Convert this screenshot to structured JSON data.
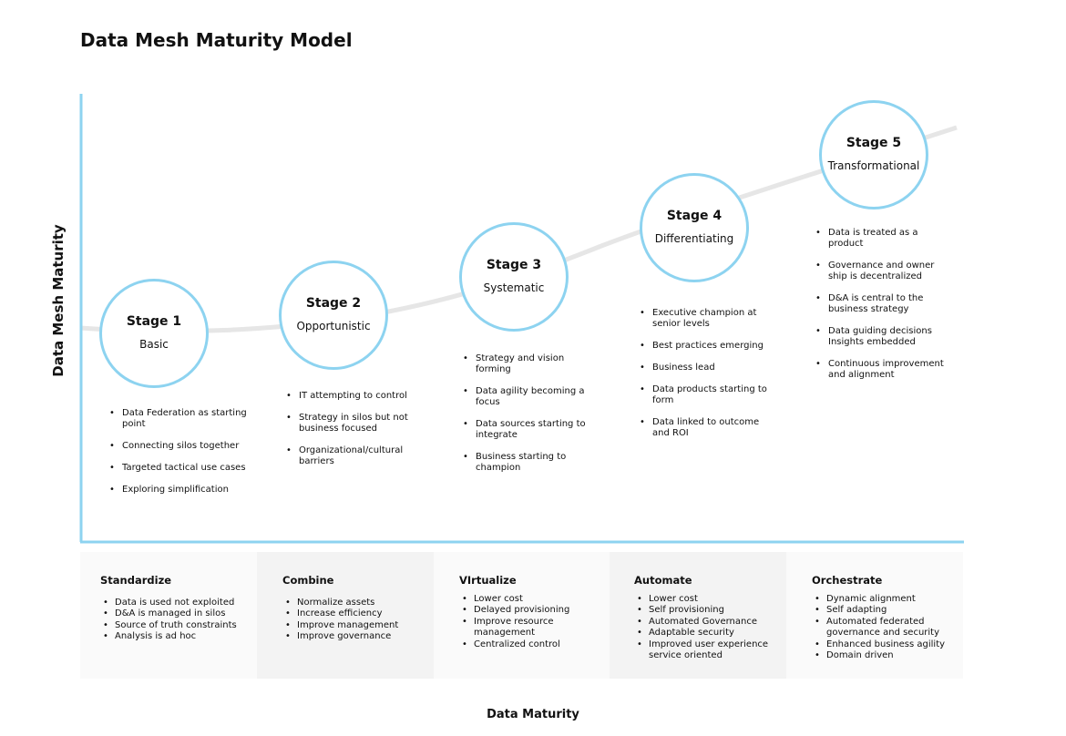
{
  "title": "Data Mesh Maturity Model",
  "y_axis_label": "Data Mesh Maturity",
  "x_axis_label": "Data  Maturity",
  "colors": {
    "accent": "#8dd3f0",
    "curve": "#e6e6e6",
    "panel_light": "#fafafa",
    "panel_dark": "#f3f3f3"
  },
  "stages": [
    {
      "label": "Stage 1",
      "name": "Basic",
      "bullets": [
        "Data Federation as starting point",
        "Connecting silos together",
        "Targeted tactical use cases",
        "Exploring simplification"
      ]
    },
    {
      "label": "Stage 2",
      "name": "Opportunistic",
      "bullets": [
        "IT attempting to control",
        "Strategy in silos but not business focused",
        "Organizational/cultural barriers"
      ]
    },
    {
      "label": "Stage 3",
      "name": "Systematic",
      "bullets": [
        "Strategy and vision forming",
        "Data agility becoming a focus",
        "Data sources starting to integrate",
        "Business starting to champion"
      ]
    },
    {
      "label": "Stage 4",
      "name": "Differentiating",
      "bullets": [
        "Executive champion at senior levels",
        "Best practices emerging",
        "Business lead",
        "Data products starting to form",
        "Data linked to outcome and ROI"
      ]
    },
    {
      "label": "Stage 5",
      "name": "Transformational",
      "bullets": [
        "Data is treated as a product",
        "Governance and owner ship is decentralized",
        "D&A is central to the business strategy",
        "Data guiding decisions Insights embedded",
        "Continuous improvement and alignment"
      ]
    }
  ],
  "panels": [
    {
      "title": "Standardize",
      "items": [
        "Data is used not exploited",
        "D&A is managed in silos",
        "Source of truth constraints",
        "Analysis is ad hoc"
      ]
    },
    {
      "title": "Combine",
      "items": [
        "Normalize assets",
        "Increase efficiency",
        "Improve management",
        "Improve governance"
      ]
    },
    {
      "title": "VIrtualize",
      "items": [
        "Lower cost",
        "Delayed provisioning",
        "Improve resource management",
        "Centralized control"
      ]
    },
    {
      "title": "Automate",
      "items": [
        "Lower cost",
        "Self provisioning",
        "Automated Governance",
        "Adaptable security",
        "Improved user experience service oriented"
      ]
    },
    {
      "title": "Orchestrate",
      "items": [
        "Dynamic alignment",
        "Self adapting",
        "Automated federated governance and security",
        "Enhanced business agility",
        "Domain driven"
      ]
    }
  ]
}
